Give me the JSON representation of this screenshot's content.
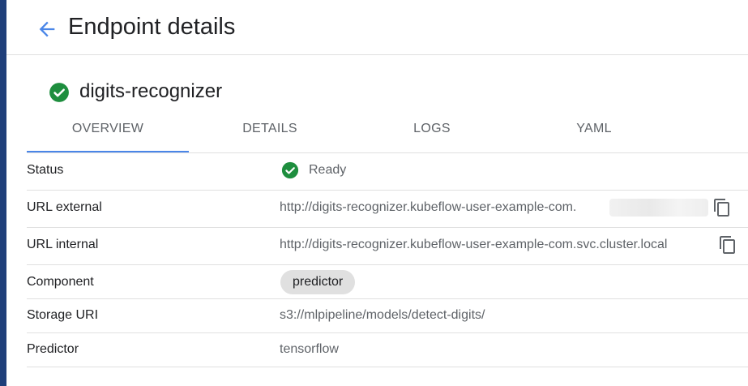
{
  "header": {
    "title": "Endpoint details",
    "back_icon": "arrow-back-icon"
  },
  "endpoint": {
    "name": "digits-recognizer",
    "status_icon": "check-circle-icon",
    "status_color": "#1e8e3e"
  },
  "tabs": [
    {
      "label": "OVERVIEW",
      "active": true
    },
    {
      "label": "DETAILS",
      "active": false
    },
    {
      "label": "LOGS",
      "active": false
    },
    {
      "label": "YAML",
      "active": false
    }
  ],
  "details": {
    "status": {
      "label": "Status",
      "value": "Ready"
    },
    "url_external": {
      "label": "URL external",
      "value": "http://digits-recognizer.kubeflow-user-example-com."
    },
    "url_internal": {
      "label": "URL internal",
      "value": "http://digits-recognizer.kubeflow-user-example-com.svc.cluster.local"
    },
    "component": {
      "label": "Component",
      "value": "predictor"
    },
    "storage_uri": {
      "label": "Storage URI",
      "value": "s3://mlpipeline/models/detect-digits/"
    },
    "predictor": {
      "label": "Predictor",
      "value": "tensorflow"
    }
  },
  "colors": {
    "accent": "#4a86e8",
    "ready": "#1e8e3e",
    "stripe": "#1f3f7a"
  }
}
